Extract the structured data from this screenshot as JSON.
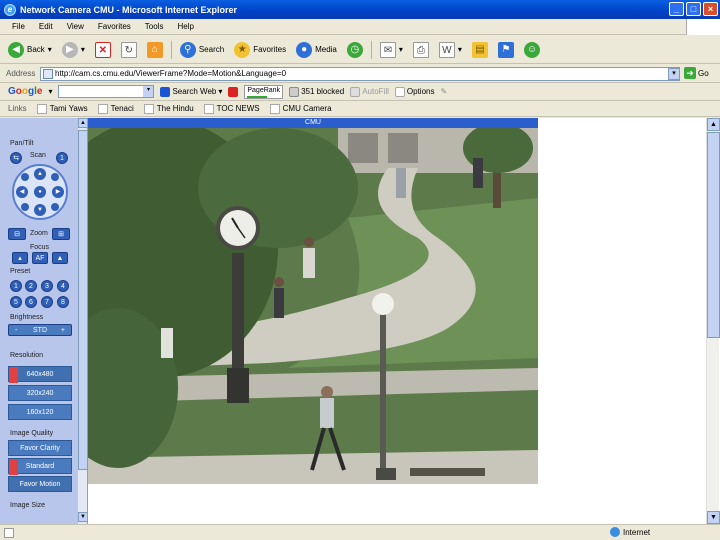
{
  "window": {
    "title": "Network Camera CMU - Microsoft Internet Explorer",
    "buttons": [
      "minimize",
      "maximize",
      "close"
    ]
  },
  "menu": [
    "File",
    "Edit",
    "View",
    "Favorites",
    "Tools",
    "Help"
  ],
  "toolbar": {
    "back": "Back",
    "search": "Search",
    "favorites": "Favorites",
    "media": "Media"
  },
  "address": {
    "label": "Address",
    "url": "http://cam.cs.cmu.edu/ViewerFrame?Mode=Motion&Language=0",
    "go": "Go"
  },
  "google": {
    "logo": "Google",
    "search_web": "Search Web",
    "pagerank": "PageRank",
    "blocked": "351 blocked",
    "autofill": "AutoFill",
    "options": "Options"
  },
  "links": {
    "label": "Links",
    "items": [
      "Tami Yaws",
      "Tenaci",
      "The Hindu",
      "TOC NEWS",
      "CMU Camera"
    ]
  },
  "sidebar": {
    "pan_tilt": "Pan/Tilt",
    "scan": "Scan",
    "zoom": "Zoom",
    "focus": "Focus",
    "af": "AF",
    "preset": "Preset",
    "preset_numbers": [
      "1",
      "2",
      "3",
      "4",
      "5",
      "6",
      "7",
      "8"
    ],
    "brightness": "Brightness",
    "brightness_minus": "-",
    "brightness_std": "STD",
    "brightness_plus": "+",
    "resolution_label": "Resolution",
    "resolutions": [
      "640x480",
      "320x240",
      "160x120"
    ],
    "image_quality_label": "Image Quality",
    "qualities": [
      "Favor Clarity",
      "Standard",
      "Favor Motion"
    ],
    "image_size_label": "Image Size"
  },
  "camera": {
    "header": "CMU"
  },
  "status": {
    "zone": "Internet"
  }
}
